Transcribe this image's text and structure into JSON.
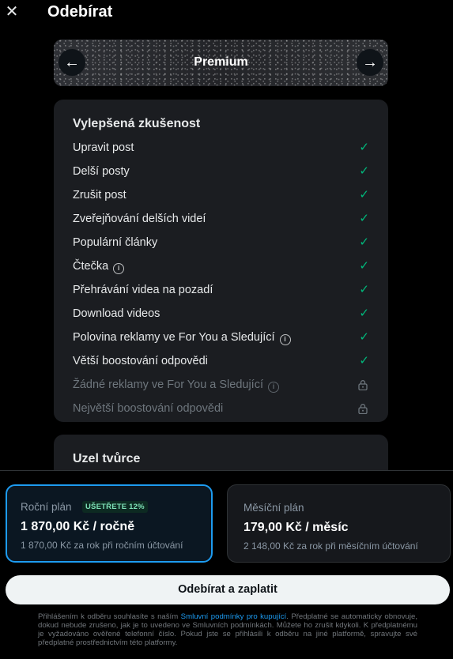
{
  "header": {
    "title": "Odebírat",
    "close_icon": "close-icon"
  },
  "banner": {
    "title": "Premium",
    "prev_icon": "arrow-left-icon",
    "next_icon": "arrow-right-icon"
  },
  "features_card": {
    "title": "Vylepšená zkušenost",
    "items": [
      {
        "label": "Upravit post",
        "status": "check",
        "info": false
      },
      {
        "label": "Delší posty",
        "status": "check",
        "info": false
      },
      {
        "label": "Zrušit post",
        "status": "check",
        "info": false
      },
      {
        "label": "Zveřejňování delších videí",
        "status": "check",
        "info": false
      },
      {
        "label": "Populární články",
        "status": "check",
        "info": false
      },
      {
        "label": "Čtečka",
        "status": "check",
        "info": true
      },
      {
        "label": "Přehrávání videa na pozadí",
        "status": "check",
        "info": false
      },
      {
        "label": "Download videos",
        "status": "check",
        "info": false
      },
      {
        "label": "Polovina reklamy ve For You a Sledující",
        "status": "check",
        "info": true
      },
      {
        "label": "Větší boostování odpovědi",
        "status": "check",
        "info": false
      },
      {
        "label": "Žádné reklamy ve For You a Sledující",
        "status": "locked",
        "info": true
      },
      {
        "label": "Největší boostování odpovědi",
        "status": "locked",
        "info": false
      }
    ]
  },
  "card2": {
    "title": "Uzel tvůrce"
  },
  "plans": {
    "yearly": {
      "label": "Roční plán",
      "badge": "UŠETŘETE 12%",
      "price": "1 870,00 Kč / ročně",
      "note": "1 870,00 Kč za rok při ročním účtování",
      "selected": true
    },
    "monthly": {
      "label": "Měsíční plán",
      "price": "179,00 Kč / měsíc",
      "note": "2 148,00 Kč za rok při měsíčním účtování",
      "selected": false
    }
  },
  "cta": {
    "label": "Odebírat a zaplatit"
  },
  "legal": {
    "before_link": "Přihlášením k odběru souhlasíte s naším ",
    "link": "Smluvní podmínky pro kupující",
    "after_link": ". Předplatné se automaticky obnovuje, dokud nebude zrušeno, jak je to uvedeno ve Smluvních podmínkách. Můžete ho zrušit kdykoli. K předplatnému je vyžadováno ověřené telefonní číslo. Pokud jste se přihlásili k odběru na jiné platformě, spravujte své předplatné prostřednictvím této platformy."
  },
  "colors": {
    "accent": "#1d9bf0",
    "check": "#00ba7c",
    "background": "#000000",
    "card": "#1b1d21"
  }
}
